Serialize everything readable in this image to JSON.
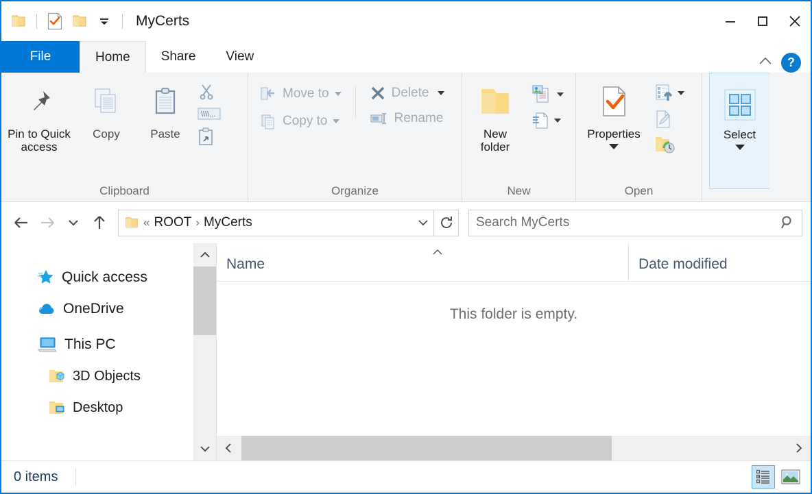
{
  "window": {
    "title": "MyCerts",
    "accent_color": "#0078d7",
    "quick_access": [
      {
        "name": "properties",
        "icon": "doc-check-icon"
      },
      {
        "name": "new-folder",
        "icon": "folder-icon"
      },
      {
        "name": "customize",
        "icon": "chevron-down-icon"
      }
    ],
    "controls": [
      {
        "name": "minimize",
        "icon": "minimize-icon"
      },
      {
        "name": "maximize",
        "icon": "maximize-icon"
      },
      {
        "name": "close",
        "icon": "close-icon"
      }
    ]
  },
  "tabs": [
    {
      "label": "File",
      "state": "file"
    },
    {
      "label": "Home",
      "state": "active"
    },
    {
      "label": "Share",
      "state": "normal"
    },
    {
      "label": "View",
      "state": "normal"
    }
  ],
  "ribbon_tools": {
    "collapse_icon": "chevron-up-icon",
    "help_label": "?"
  },
  "ribbon": {
    "groups": [
      {
        "label": "Clipboard",
        "big": [
          {
            "label": "Pin to Quick\naccess",
            "line1": "Pin to Quick",
            "line2": "access",
            "icon": "pin-icon",
            "enabled": true
          },
          {
            "label": "Copy",
            "icon": "copy-icon",
            "enabled": false
          },
          {
            "label": "Paste",
            "icon": "paste-icon",
            "enabled": false
          }
        ],
        "small": [
          {
            "label": "",
            "icon": "cut-icon",
            "enabled": false
          },
          {
            "label": "",
            "icon": "copy-path-icon",
            "enabled": false
          },
          {
            "label": "",
            "icon": "paste-shortcut-icon",
            "enabled": false
          }
        ]
      },
      {
        "label": "Organize",
        "items": [
          {
            "label": "Move to",
            "icon": "move-to-icon",
            "dropdown": true,
            "enabled": false
          },
          {
            "label": "Copy to",
            "icon": "copy-to-icon",
            "dropdown": true,
            "enabled": false
          },
          {
            "label": "Delete",
            "icon": "delete-icon",
            "dropdown": true,
            "enabled": false
          },
          {
            "label": "Rename",
            "icon": "rename-icon",
            "dropdown": false,
            "enabled": false
          }
        ]
      },
      {
        "label": "New",
        "big": [
          {
            "line1": "New",
            "line2": "folder",
            "icon": "new-folder-icon",
            "enabled": true
          }
        ],
        "small": [
          {
            "icon": "new-item-icon",
            "dropdown": true,
            "enabled": true
          },
          {
            "icon": "easy-access-icon",
            "dropdown": true,
            "enabled": true
          }
        ]
      },
      {
        "label": "Open",
        "big": [
          {
            "line1": "Properties",
            "line2": "",
            "icon": "properties-icon",
            "enabled": true,
            "dropdown": true
          }
        ],
        "small": [
          {
            "icon": "open-icon",
            "dropdown": true,
            "enabled": false
          },
          {
            "icon": "edit-icon",
            "dropdown": false,
            "enabled": false
          },
          {
            "icon": "history-icon",
            "dropdown": false,
            "enabled": true
          }
        ]
      },
      {
        "label": "",
        "big": [
          {
            "line1": "Select",
            "line2": "",
            "icon": "select-icon",
            "enabled": true,
            "dropdown": true
          }
        ],
        "highlighted": true
      }
    ]
  },
  "addressbar": {
    "back_icon": "arrow-left-icon",
    "forward_icon": "arrow-right-icon",
    "recent_icon": "chevron-down-icon",
    "up_icon": "arrow-up-icon",
    "folder_icon": "folder-icon",
    "prefix": "«",
    "crumbs": [
      "ROOT",
      "MyCerts"
    ],
    "separator": "›",
    "dropdown_icon": "chevron-down-icon",
    "refresh_icon": "refresh-icon"
  },
  "search": {
    "placeholder": "Search MyCerts",
    "value": "",
    "icon": "search-icon"
  },
  "sidebar": {
    "items": [
      {
        "label": "Quick access",
        "icon": "star-icon",
        "indent": false
      },
      {
        "label": "OneDrive",
        "icon": "cloud-icon",
        "indent": false
      },
      {
        "label": "This PC",
        "icon": "monitor-icon",
        "indent": false
      },
      {
        "label": "3D Objects",
        "icon": "folder-3d-icon",
        "indent": true
      },
      {
        "label": "Desktop",
        "icon": "folder-desktop-icon",
        "indent": true
      }
    ]
  },
  "filelist": {
    "columns": [
      {
        "label": "Name",
        "sorted": "asc"
      },
      {
        "label": "Date modified",
        "sorted": ""
      }
    ],
    "rows": [],
    "empty_message": "This folder is empty."
  },
  "statusbar": {
    "item_count": "0 items",
    "views": [
      {
        "name": "details-view",
        "icon": "details-view-icon",
        "active": true
      },
      {
        "name": "large-icons-view",
        "icon": "thumbnail-view-icon",
        "active": false
      }
    ]
  }
}
